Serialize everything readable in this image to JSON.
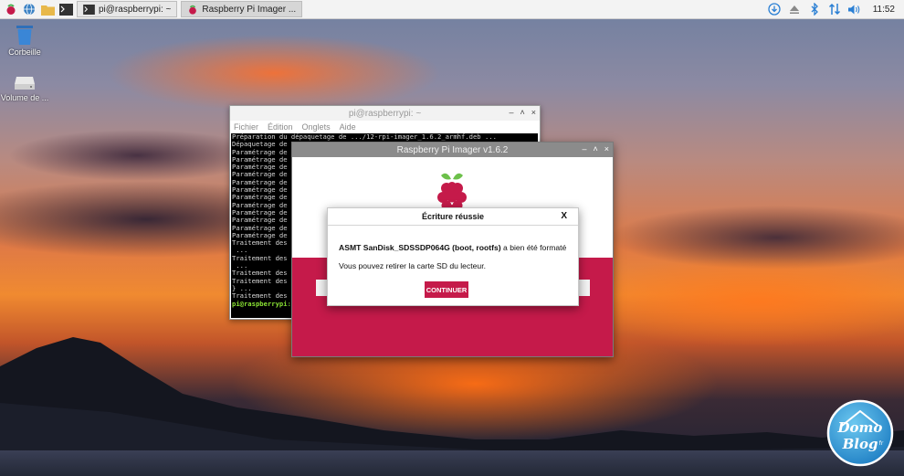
{
  "taskbar": {
    "tasks": [
      {
        "label": "pi@raspberrypi: ~"
      },
      {
        "label": "Raspberry Pi Imager ..."
      }
    ],
    "clock": "11:52",
    "icons": [
      "raspberry-menu-icon",
      "web-browser-icon",
      "file-manager-icon",
      "terminal-icon",
      "download-icon",
      "eject-icon",
      "bluetooth-icon",
      "network-arrows-icon",
      "volume-icon"
    ]
  },
  "desktop": {
    "icons": [
      {
        "label": "Corbeille",
        "icon": "trash-icon"
      },
      {
        "label": "Volume de ...",
        "icon": "drive-icon"
      }
    ]
  },
  "terminal": {
    "title": "pi@raspberrypi: ~",
    "menu": [
      "Fichier",
      "Édition",
      "Onglets",
      "Aide"
    ],
    "lines": [
      "Préparation du dépaquetage de .../12-rpi-imager_1.6.2_armhf.deb ...",
      "Dépaquetage de r",
      "Paramétrage de l",
      "Paramétrage de l",
      "Paramétrage de l",
      "Paramétrage de q",
      "Paramétrage de q",
      "Paramétrage de q",
      "Paramétrage de q",
      "Paramétrage de l",
      "Paramétrage de q",
      "Paramétrage de q",
      "Paramétrage de q",
      "Paramétrage de r",
      "Traitement des a",
      " ...",
      "Traitement des a",
      " ...",
      "Traitement des a",
      "Traitement des a",
      "} ...",
      "Traitement des a"
    ],
    "prompt": "pi@raspberrypi:~"
  },
  "imager": {
    "title": "Raspberry Pi Imager v1.6.2"
  },
  "dialog": {
    "title": "Écriture réussie",
    "close": "X",
    "device_bold": "ASMT SanDisk_SDSSDP064G (boot, rootfs)",
    "device_rest": " a bien été formaté",
    "message": "Vous pouvez retirer la carte SD du lecteur.",
    "button": "CONTINUER"
  },
  "watermark": {
    "text1": "Domo",
    "text2": "Blog",
    "suffix": "fr"
  },
  "colors": {
    "raspberry_red": "#c51a4a",
    "taskbar_bg": "#f3f3f3",
    "tray_blue": "#2a7fd4"
  }
}
